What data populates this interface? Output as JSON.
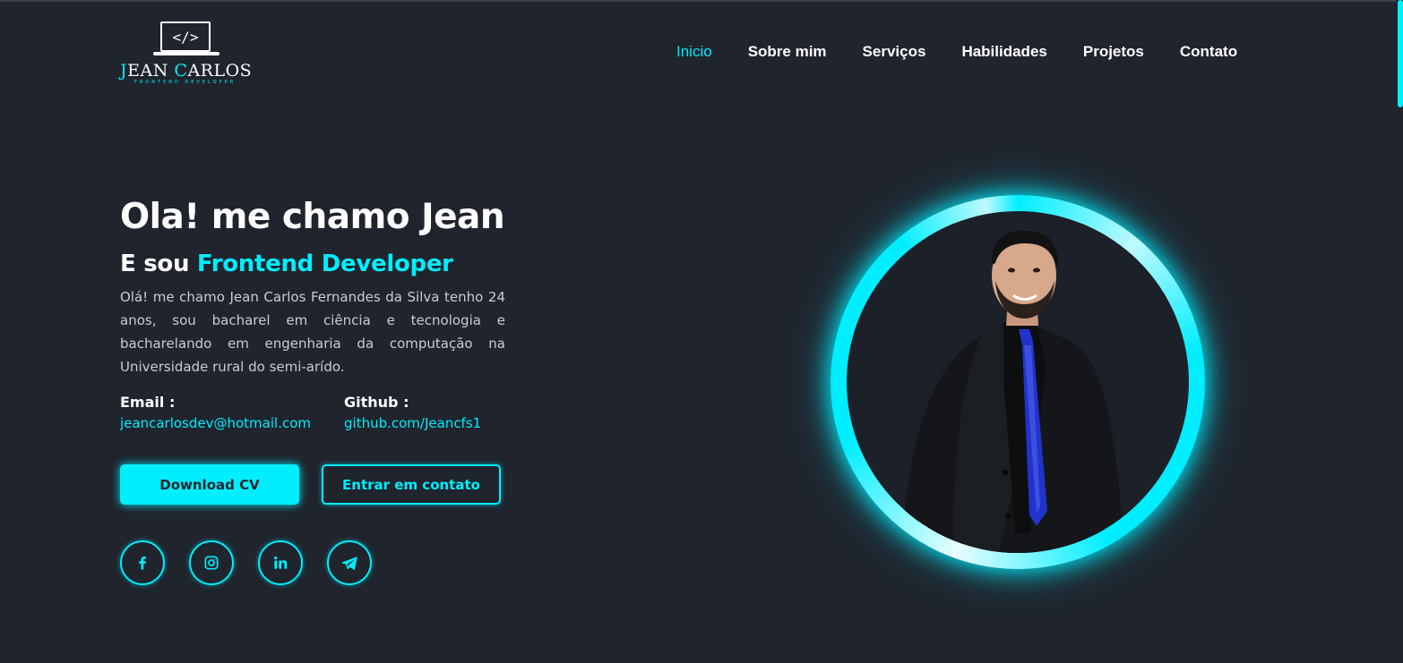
{
  "logo": {
    "code_glyph": "</>",
    "name_first_initial": "J",
    "name_first_rest": "EAN ",
    "name_last_initial": "C",
    "name_last_rest": "ARLOS",
    "tagline": "FRONTEND DEVELOPER"
  },
  "nav": {
    "items": [
      {
        "label": "Inicio",
        "active": true
      },
      {
        "label": "Sobre mim",
        "active": false
      },
      {
        "label": "Serviços",
        "active": false
      },
      {
        "label": "Habilidades",
        "active": false
      },
      {
        "label": "Projetos",
        "active": false
      },
      {
        "label": "Contato",
        "active": false
      }
    ]
  },
  "hero": {
    "title": "Ola! me chamo Jean",
    "subtitle_prefix": "E sou ",
    "subtitle_role": "Frontend Developer",
    "description": "Olá! me chamo Jean Carlos Fernandes da Silva tenho 24 anos, sou bacharel em ciência e tecnologia e bacharelando em engenharia da computação na Universidade rural do semi-arído.",
    "email_label": "Email :",
    "email_value": "jeancarlosdev@hotmail.com",
    "github_label": "Github :",
    "github_value": "github.com/Jeancfs1",
    "download_cv": "Download CV",
    "contact_button": "Entrar em contato"
  },
  "socials": [
    {
      "icon": "facebook-icon"
    },
    {
      "icon": "instagram-icon"
    },
    {
      "icon": "linkedin-icon"
    },
    {
      "icon": "telegram-icon"
    }
  ],
  "colors": {
    "background": "#1f242d",
    "accent": "#00eeff",
    "text": "#ffffff",
    "muted_text": "#c9cdd3"
  }
}
